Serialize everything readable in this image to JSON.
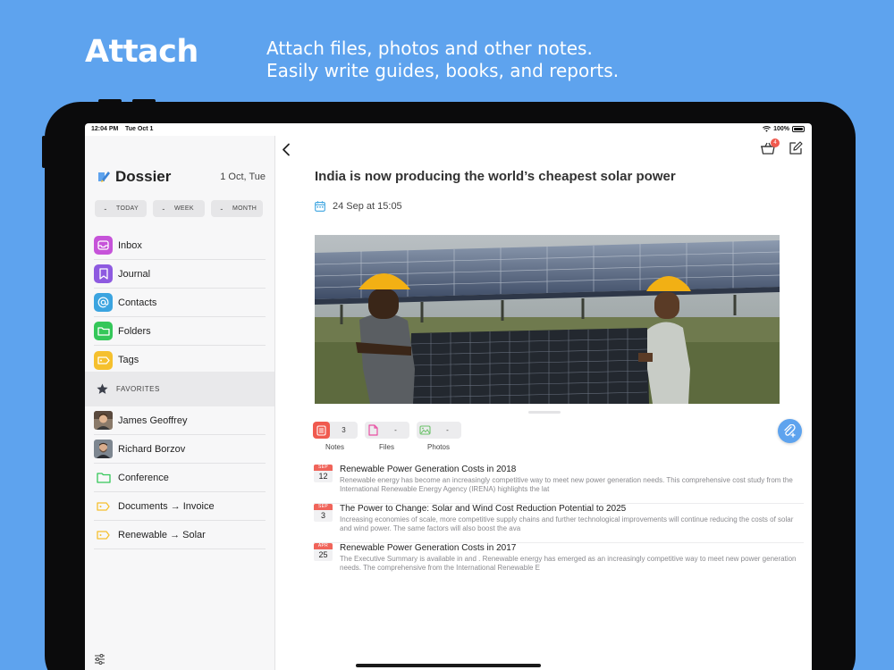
{
  "hero": {
    "title": "Attach",
    "line1": "Attach files, photos and other notes.",
    "line2": "Easily write guides, books, and reports."
  },
  "status": {
    "time": "12:04 PM",
    "date": "Tue Oct 1",
    "battery": "100%"
  },
  "sidebar": {
    "app_name": "Dossier",
    "date": "1 Oct, Tue",
    "ranges": [
      {
        "value": "-",
        "label": "TODAY"
      },
      {
        "value": "-",
        "label": "WEEK"
      },
      {
        "value": "-",
        "label": "MONTH"
      }
    ],
    "menu": [
      {
        "label": "Inbox",
        "icon": "inbox-icon",
        "color": "#c653d9"
      },
      {
        "label": "Journal",
        "icon": "bookmark-icon",
        "color": "#8e5ae0"
      },
      {
        "label": "Contacts",
        "icon": "at-icon",
        "color": "#3ba4e0"
      },
      {
        "label": "Folders",
        "icon": "folder-icon",
        "color": "#34c759"
      },
      {
        "label": "Tags",
        "icon": "tag-icon",
        "color": "#f5c02e"
      }
    ],
    "favorites_label": "FAVORITES",
    "favorites": [
      {
        "label": "James Geoffrey",
        "icon": "avatar"
      },
      {
        "label": "Richard Borzov",
        "icon": "avatar"
      },
      {
        "label": "Conference",
        "icon": "folder-outline-icon"
      },
      {
        "label": "Documents → Invoice",
        "icon": "tag-outline-icon"
      },
      {
        "label": "Renewable  → Solar",
        "icon": "tag-outline-icon"
      }
    ]
  },
  "note": {
    "title": "India is now producing the world’s cheapest solar power",
    "date": "24 Sep at 15:05",
    "basket_badge": "4",
    "attachments": [
      {
        "label": "Notes",
        "count": "3",
        "color": "#f05a4f"
      },
      {
        "label": "Files",
        "count": "-",
        "color": "#e84fa3"
      },
      {
        "label": "Photos",
        "count": "-",
        "color": "#6cc26a"
      }
    ],
    "related": [
      {
        "month": "SEP",
        "day": "12",
        "title": "Renewable Power Generation Costs in 2018",
        "excerpt": "Renewable energy has become an increasingly competitive way to meet new power generation needs. This comprehensive cost study from the International Renewable Energy Agency (IRENA) highlights the lat"
      },
      {
        "month": "SEP",
        "day": "3",
        "title": "The Power to Change: Solar and Wind Cost Reduction Potential to 2025",
        "excerpt": "Increasing economies of scale, more competitive supply chains and further technological improvements will continue reducing the costs of solar and wind power. The same factors will also boost the ava"
      },
      {
        "month": "APR",
        "day": "25",
        "title": "Renewable Power Generation Costs in 2017",
        "excerpt": "The Executive Summary is available in  and . Renewable energy has emerged as an increasingly competitive way to meet new power generation needs. The comprehensive  from the International Renewable E"
      }
    ]
  }
}
